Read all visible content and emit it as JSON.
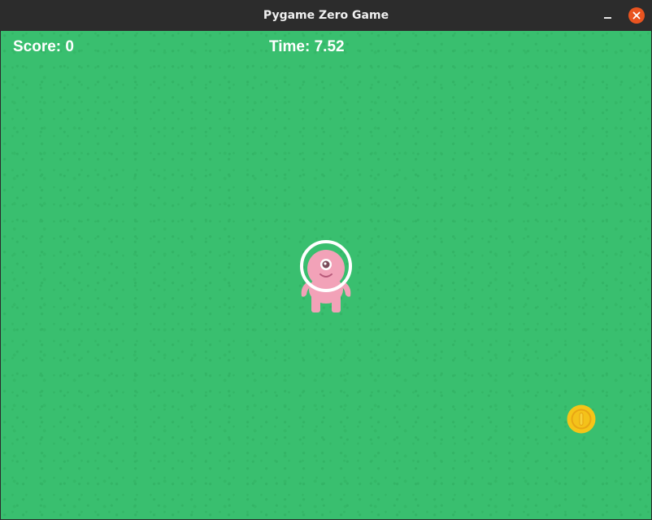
{
  "window": {
    "title": "Pygame Zero Game",
    "close_button_color": "#e95420"
  },
  "hud": {
    "score_text": "Score: 0",
    "time_text": "Time: 7.52"
  },
  "game": {
    "background_color": "#39bf6f",
    "sprites": [
      {
        "name": "alien",
        "color": "#f2a2b8",
        "icon": "pink-alien-icon"
      },
      {
        "name": "coin",
        "color": "#f5c518",
        "icon": "gold-coin-icon"
      }
    ]
  }
}
